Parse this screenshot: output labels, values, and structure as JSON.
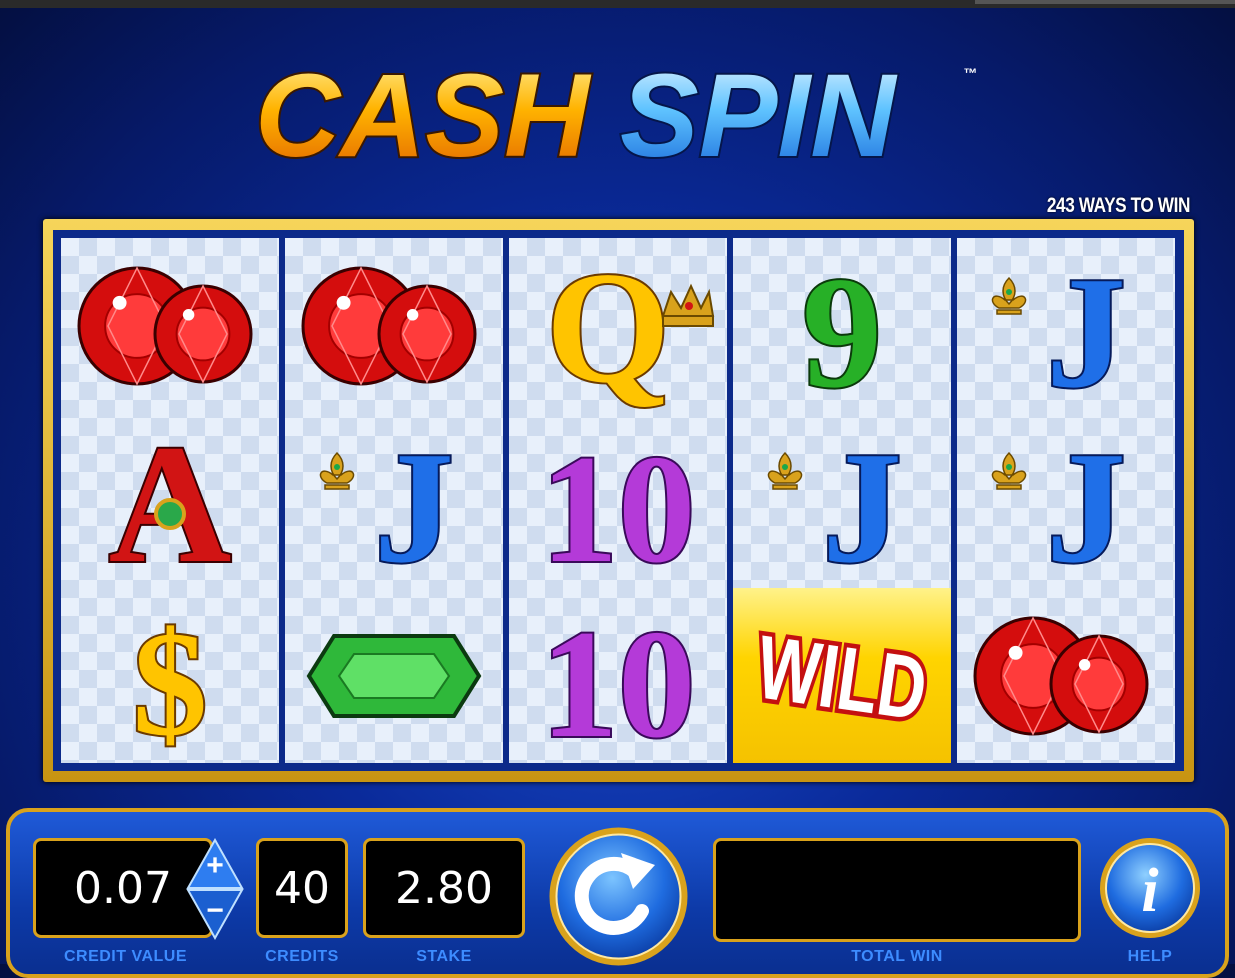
{
  "title": "Cash Spin",
  "title_parts": [
    "CASH",
    "SPIN"
  ],
  "trademark": "™",
  "ways_to_win": "243 WAYS TO WIN",
  "reels": [
    [
      "ruby-gems",
      "ace",
      "dollar-sign"
    ],
    [
      "ruby-gems",
      "jack",
      "emerald"
    ],
    [
      "queen",
      "ten",
      "ten"
    ],
    [
      "nine",
      "jack",
      "wild"
    ],
    [
      "jack",
      "jack",
      "ruby-gems"
    ]
  ],
  "symbol_text": {
    "ace": "A",
    "queen": "Q",
    "jack": "J",
    "ten": "10",
    "nine": "9",
    "wild": "WILD",
    "dollar": "$"
  },
  "credit_value": {
    "value": "0.07",
    "label": "CREDIT VALUE"
  },
  "credits": {
    "value": "40",
    "label": "CREDITS"
  },
  "stake": {
    "value": "2.80",
    "label": "STAKE"
  },
  "total_win": {
    "value": "",
    "label": "TOTAL WIN"
  },
  "help": {
    "label": "HELP",
    "glyph": "i"
  },
  "stepper": {
    "plus": "+",
    "minus": "−"
  },
  "icons": [
    "spin-icon",
    "help-icon",
    "plus-icon",
    "minus-icon"
  ],
  "colors": {
    "gold": "#d9a21c",
    "label_blue": "#3d8cff",
    "panel_blue": "#1f5ad8"
  }
}
